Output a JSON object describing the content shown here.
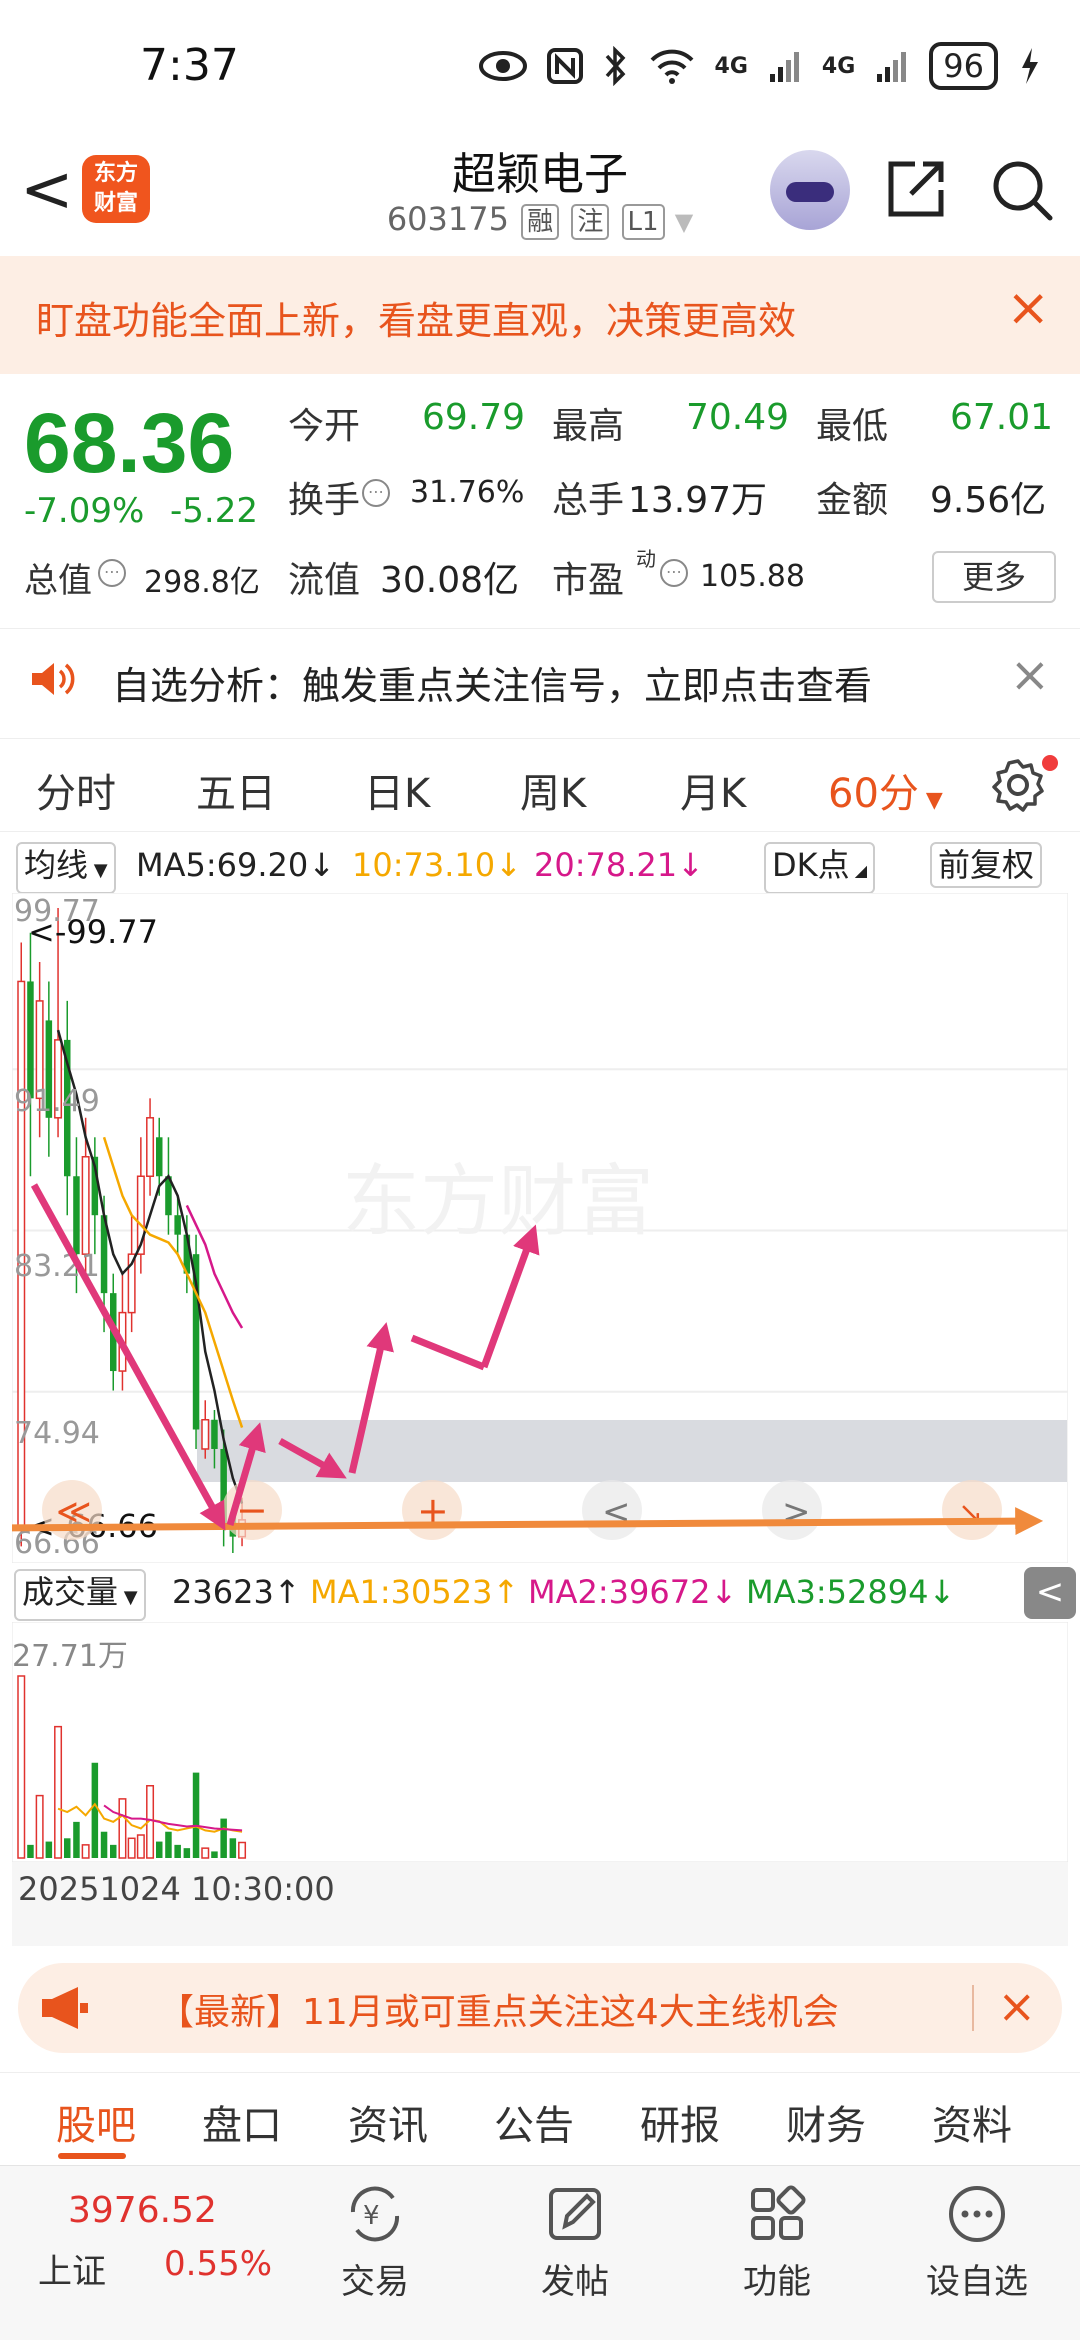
{
  "status_bar": {
    "time": "7:37",
    "battery": "96",
    "net1": "4G",
    "net2": "4G"
  },
  "header": {
    "back_label": "<",
    "logo_text_1": "东方",
    "logo_text_2": "财富",
    "title": "超颖电子",
    "code": "603175",
    "tag1": "融",
    "tag2": "注",
    "tag3": "L1"
  },
  "banner": {
    "text": "盯盘功能全面上新，看盘更直观，决策更高效",
    "close": "×"
  },
  "quote": {
    "price": "68.36",
    "change_pct": "-7.09%",
    "change": "-5.22",
    "open_label": "今开",
    "open": "69.79",
    "high_label": "最高",
    "high": "70.49",
    "low_label": "最低",
    "low": "67.01",
    "turnover_label": "换手",
    "turnover": "31.76%",
    "volume_label": "总手",
    "volume": "13.97万",
    "amount_label": "金额",
    "amount": "9.56亿",
    "mktcap_label": "总值",
    "mktcap": "298.8亿",
    "float_label": "流值",
    "float": "30.08亿",
    "pe_label": "市盈",
    "pe_sup": "动",
    "pe": "105.88",
    "more": "更多"
  },
  "alert": {
    "text": "自选分析：触发重点关注信号，立即点击查看",
    "close": "×"
  },
  "period_tabs": [
    "分时",
    "五日",
    "日K",
    "周K",
    "月K",
    "60分"
  ],
  "period_active": "60分",
  "ma_row": {
    "ma_select": "均线",
    "ma5": "MA5:69.20↓",
    "ma10": "10:73.10↓",
    "ma20": "20:78.21↓",
    "dk": "DK点",
    "adjust": "前复权"
  },
  "price_chart": {
    "y_labels": [
      "99.77",
      "91.49",
      "83.21",
      "74.94",
      "66.66"
    ],
    "max_label": "<-99.77",
    "min_label": "<-66.66",
    "watermark": "东方财富",
    "ctrl_left": "≪",
    "ctrl_minus": "−",
    "ctrl_plus": "+",
    "ctrl_prev": "<",
    "ctrl_next": ">",
    "ctrl_expand": "↘"
  },
  "volume_bar": {
    "select": "成交量",
    "vol": "23623↑",
    "ma1": "MA1:30523↑",
    "ma2": "MA2:39672↓",
    "ma3": "MA3:52894↓",
    "collapse": "<"
  },
  "volume_chart": {
    "max_label": "27.71万"
  },
  "date_label": "20251024 10:30",
  "date_label_end": ":00",
  "news": {
    "text": "【最新】11月或可重点关注这4大主线机会",
    "close": "×"
  },
  "bottom_tabs": [
    "股吧",
    "盘口",
    "资讯",
    "公告",
    "研报",
    "财务",
    "资料"
  ],
  "bottom_tab_active": "股吧",
  "bottom_nav": {
    "index_value": "3976.52",
    "index_name": "上证",
    "index_change": "0.55%",
    "items": [
      "交易",
      "发帖",
      "功能",
      "设自选"
    ]
  },
  "colors": {
    "up": "#e0322e",
    "down": "#1a9b2c",
    "accent": "#e8541d",
    "annotation": "#e0387a",
    "support_line": "#f08a3c"
  },
  "chart_data": {
    "type": "candlestick",
    "ylim": [
      66.66,
      99.77
    ],
    "candles": [
      {
        "o": 68.0,
        "c": 96.0,
        "h": 98.0,
        "l": 67.0
      },
      {
        "o": 96.0,
        "c": 90.0,
        "h": 98.5,
        "l": 86.0
      },
      {
        "o": 90.0,
        "c": 95.0,
        "h": 97.0,
        "l": 88.0
      },
      {
        "o": 94.0,
        "c": 89.0,
        "h": 96.0,
        "l": 87.0
      },
      {
        "o": 89.0,
        "c": 93.0,
        "h": 99.77,
        "l": 88.0
      },
      {
        "o": 93.0,
        "c": 86.0,
        "h": 95.0,
        "l": 84.0
      },
      {
        "o": 86.0,
        "c": 82.0,
        "h": 88.0,
        "l": 80.0
      },
      {
        "o": 82.0,
        "c": 87.0,
        "h": 89.0,
        "l": 81.0
      },
      {
        "o": 87.0,
        "c": 84.0,
        "h": 88.0,
        "l": 82.0
      },
      {
        "o": 84.0,
        "c": 80.0,
        "h": 85.0,
        "l": 78.0
      },
      {
        "o": 80.0,
        "c": 76.0,
        "h": 81.0,
        "l": 75.0
      },
      {
        "o": 76.0,
        "c": 79.0,
        "h": 81.0,
        "l": 75.0
      },
      {
        "o": 79.0,
        "c": 82.0,
        "h": 84.0,
        "l": 78.0
      },
      {
        "o": 82.0,
        "c": 86.0,
        "h": 88.0,
        "l": 81.0
      },
      {
        "o": 86.0,
        "c": 89.0,
        "h": 90.0,
        "l": 85.0
      },
      {
        "o": 88.0,
        "c": 86.0,
        "h": 89.0,
        "l": 85.0
      },
      {
        "o": 86.0,
        "c": 84.0,
        "h": 88.0,
        "l": 83.0
      },
      {
        "o": 84.0,
        "c": 83.0,
        "h": 85.0,
        "l": 82.0
      },
      {
        "o": 83.0,
        "c": 81.0,
        "h": 84.0,
        "l": 80.0
      },
      {
        "o": 82.0,
        "c": 73.0,
        "h": 83.0,
        "l": 72.0
      },
      {
        "o": 72.0,
        "c": 73.5,
        "h": 74.5,
        "l": 71.5
      },
      {
        "o": 73.5,
        "c": 72.0,
        "h": 74.0,
        "l": 71.0
      },
      {
        "o": 72.0,
        "c": 68.0,
        "h": 73.0,
        "l": 67.0
      },
      {
        "o": 68.5,
        "c": 67.5,
        "h": 69.0,
        "l": 66.66
      },
      {
        "o": 67.5,
        "c": 68.36,
        "h": 69.5,
        "l": 67.01
      }
    ],
    "ma5": [
      null,
      null,
      null,
      null,
      93.5,
      91.8,
      90.2,
      88.0,
      86.5,
      84.0,
      82.0,
      81.0,
      81.5,
      82.5,
      84.0,
      85.5,
      86.0,
      85.0,
      83.0,
      80.5,
      77.0,
      75.0,
      72.5,
      70.5,
      69.2
    ],
    "ma10": [
      null,
      null,
      null,
      null,
      null,
      null,
      null,
      null,
      null,
      88.0,
      86.5,
      85.0,
      84.0,
      83.5,
      83.0,
      82.8,
      82.6,
      82.0,
      81.0,
      80.0,
      79.0,
      77.5,
      76.0,
      74.5,
      73.1
    ],
    "ma20": [
      null,
      null,
      null,
      null,
      null,
      null,
      null,
      null,
      null,
      null,
      null,
      null,
      null,
      null,
      null,
      null,
      null,
      null,
      84.5,
      83.5,
      82.5,
      81.0,
      80.0,
      79.0,
      78.21
    ],
    "volumes": [
      27.71,
      2.0,
      9.5,
      2.5,
      20.0,
      3.0,
      5.5,
      2.0,
      14.5,
      4.0,
      2.0,
      9.0,
      3.0,
      3.5,
      11.0,
      2.5,
      4.0,
      2.0,
      1.5,
      13.0,
      1.5,
      1.0,
      6.0,
      3.0,
      2.36
    ],
    "vol_ma1": [
      null,
      null,
      null,
      null,
      7.5,
      7.0,
      7.8,
      6.5,
      8.2,
      6.0,
      5.5,
      6.5,
      5.0,
      4.5,
      5.8,
      5.6,
      4.5,
      4.2,
      4.5,
      4.8,
      4.2,
      4.0,
      4.5,
      4.2,
      4.0
    ],
    "vol_ma2": [
      null,
      null,
      null,
      null,
      null,
      null,
      null,
      null,
      null,
      8.0,
      7.0,
      6.5,
      6.0,
      6.0,
      5.8,
      5.5,
      5.2,
      5.0,
      4.8,
      4.9,
      4.7,
      4.5,
      4.4,
      4.3,
      4.2
    ],
    "volume_ylim": [
      0,
      27.71
    ]
  }
}
